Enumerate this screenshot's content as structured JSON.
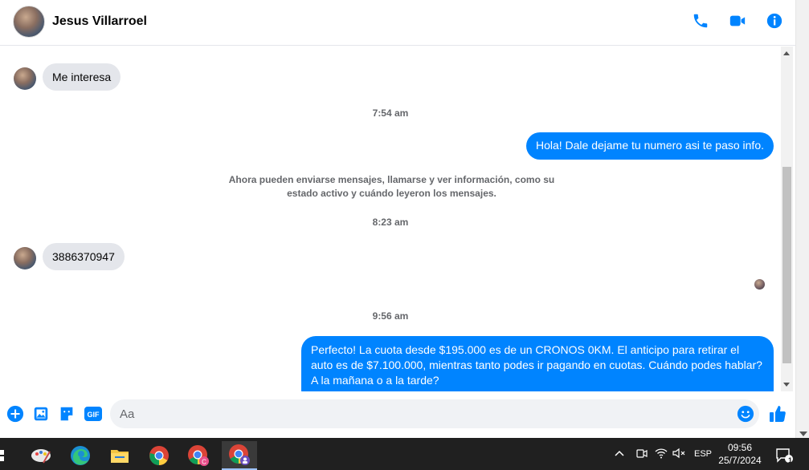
{
  "header": {
    "contact_name": "Jesus Villarroel"
  },
  "messages": {
    "incoming_1": "Me interesa",
    "time_1": "7:54 am",
    "outgoing_1": "Hola! Dale dejame tu numero  asi te paso info.",
    "system_note": "Ahora pueden enviarse mensajes, llamarse y ver información, como su estado activo y cuándo leyeron los mensajes.",
    "time_2": "8:23 am",
    "incoming_2": "3886370947",
    "time_3": "9:56 am",
    "outgoing_2": "Perfecto! La cuota desde $195.000 es de un CRONOS 0KM. El anticipo para retirar el auto es de $7.100.000, mientras tanto podes ir pagando en cuotas. Cuándo podes hablar? A la mañana o a la tarde?"
  },
  "composer": {
    "placeholder": "Aa",
    "gif_label": "GIF"
  },
  "taskbar": {
    "language": "ESP",
    "time": "09:56",
    "date": "25/7/2024",
    "notification_count": "1"
  },
  "colors": {
    "accent": "#0084ff",
    "bubble_in": "#e4e6eb",
    "taskbar": "#202020"
  }
}
